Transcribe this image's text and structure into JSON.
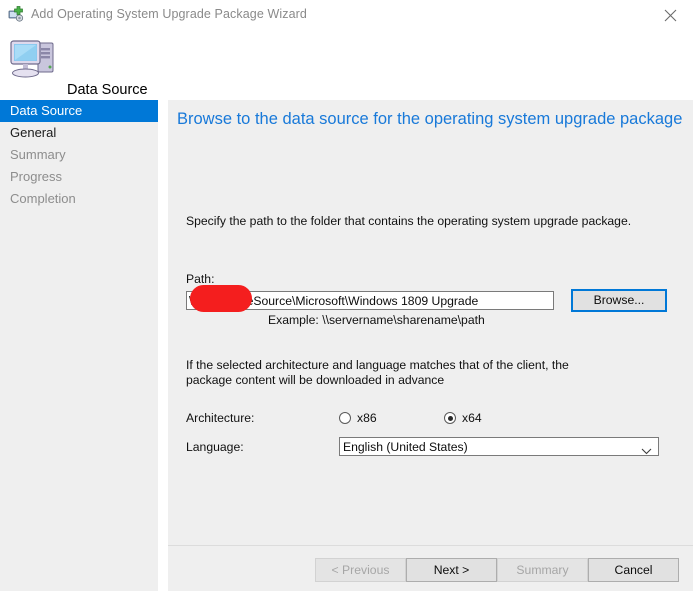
{
  "window": {
    "title": "Add Operating System Upgrade Package Wizard",
    "title_icon": "add-package-icon",
    "close_icon": "close-icon"
  },
  "header": {
    "icon": "computer-icon",
    "title": "Data Source"
  },
  "sidebar": {
    "items": [
      {
        "label": "Data Source",
        "state": "active"
      },
      {
        "label": "General",
        "state": "visited"
      },
      {
        "label": "Summary",
        "state": "pending"
      },
      {
        "label": "Progress",
        "state": "pending"
      },
      {
        "label": "Completion",
        "state": "pending"
      }
    ]
  },
  "content": {
    "heading": "Browse to the data source for the operating system upgrade package",
    "instruction": "Specify the path to the folder that contains the operating system upgrade package.",
    "path_label": "Path:",
    "path_value": "\\                $\\PackageSource\\Microsoft\\Windows 1809 Upgrade",
    "path_redacted": true,
    "example_text": "Example: \\\\servername\\sharename\\path",
    "browse_label": "Browse...",
    "arch_note": "If the selected architecture and language matches that of the client, the package content will be downloaded in advance",
    "architecture_label": "Architecture:",
    "architecture_options": [
      {
        "label": "x86",
        "checked": false
      },
      {
        "label": "x64",
        "checked": true
      }
    ],
    "language_label": "Language:",
    "language_value": "English (United States)",
    "language_chevron": "chevron-down-icon"
  },
  "footer": {
    "buttons": [
      {
        "label": "< Previous",
        "enabled": false
      },
      {
        "label": "Next >",
        "enabled": true
      },
      {
        "label": "Summary",
        "enabled": false
      },
      {
        "label": "Cancel",
        "enabled": true
      }
    ]
  },
  "colors": {
    "accent": "#0078d7",
    "heading": "#1879d9",
    "panel": "#efefef",
    "redaction": "#f41e1e"
  }
}
